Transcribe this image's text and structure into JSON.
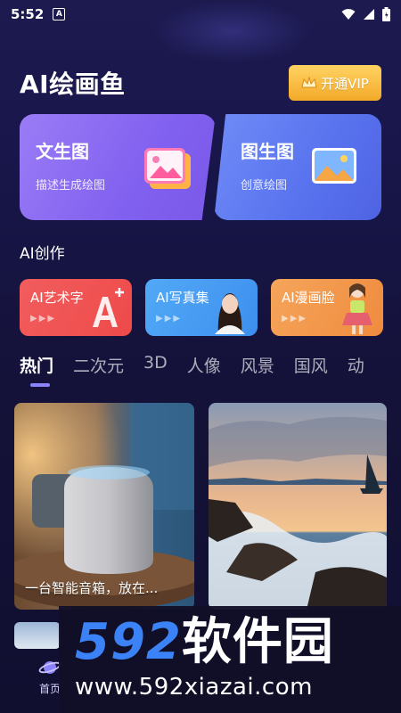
{
  "status_bar": {
    "time": "5:52",
    "badge": "A"
  },
  "header": {
    "title": "AI绘画鱼",
    "vip_label": "开通VIP"
  },
  "feature_cards": [
    {
      "title": "文生图",
      "subtitle": "描述生成绘图"
    },
    {
      "title": "图生图",
      "subtitle": "创意绘图"
    }
  ],
  "section": {
    "title": "AI创作"
  },
  "creation_cards": [
    {
      "label": "AI艺术字"
    },
    {
      "label": "AI写真集"
    },
    {
      "label": "AI漫画脸"
    }
  ],
  "tabs": [
    "热门",
    "二次元",
    "3D",
    "人像",
    "风景",
    "国风",
    "动"
  ],
  "feed": [
    {
      "caption": "一台智能音箱，放在..."
    },
    {
      "caption": ""
    }
  ],
  "nav": {
    "home_label": "首页"
  },
  "watermark": {
    "brand_num": "592",
    "brand_cn": "软件园",
    "url": "www.592xiazai.com"
  },
  "colors": {
    "background": "#141238",
    "vip": "#f3a928",
    "card_purple": "#8161ef",
    "card_blue": "#5872ee",
    "red": "#ee4a4a",
    "sky": "#3d8fee",
    "orange": "#ef8b3e",
    "tab_indicator": "#8c83ff",
    "watermark_blue": "#3b82f6"
  },
  "icons": [
    "wifi-icon",
    "signal-icon",
    "battery-icon",
    "crown-icon",
    "image-icon",
    "letter-a-plus-icon",
    "planet-icon"
  ]
}
